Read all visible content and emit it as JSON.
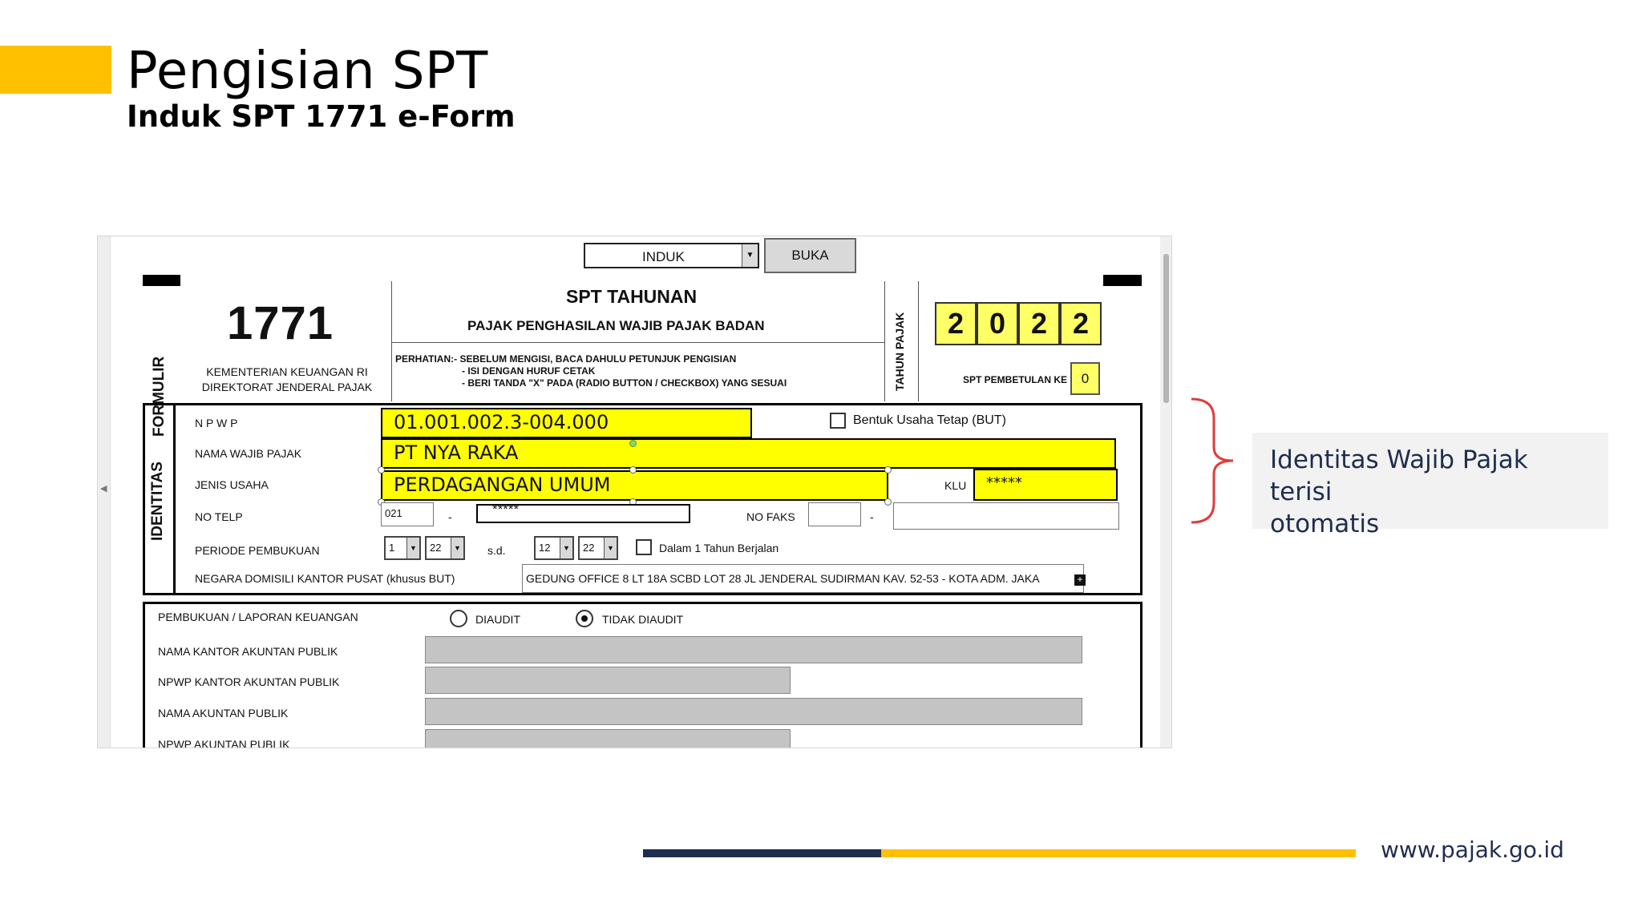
{
  "slide": {
    "title": "Pengisian SPT",
    "subtitle": "Induk SPT 1771 e-Form",
    "footer_url": "www.pajak.go.id",
    "accent_color": "#FFC000",
    "navy_color": "#1f2d50"
  },
  "callout": {
    "line1": "Identitas Wajib Pajak terisi",
    "line2": "otomatis"
  },
  "form": {
    "dropdown_value": "INDUK",
    "open_button": "BUKA",
    "formulir_label": "FORMULIR",
    "form_number": "1771",
    "ministry_line1": "KEMENTERIAN KEUANGAN RI",
    "ministry_line2": "DIREKTORAT JENDERAL PAJAK",
    "spt_title": "SPT TAHUNAN",
    "spt_subtitle": "PAJAK PENGHASILAN WAJIB PAJAK BADAN",
    "notice_line1": "PERHATIAN:- SEBELUM MENGISI, BACA DAHULU PETUNJUK PENGISIAN",
    "notice_line2": "- ISI DENGAN HURUF CETAK",
    "notice_line3": "- BERI TANDA \"X\" PADA (RADIO BUTTON / CHECKBOX) YANG SESUAI",
    "tahun_pajak_label": "TAHUN PAJAK",
    "year_digits": [
      "2",
      "0",
      "2",
      "2"
    ],
    "pembetulan_label": "SPT PEMBETULAN KE",
    "pembetulan_value": "0",
    "identitas_label": "IDENTITAS",
    "npwp_label": "N P W P",
    "npwp_value": "01.001.002.3-004.000",
    "but_label": "Bentuk Usaha Tetap (BUT)",
    "nama_label": "NAMA WAJIB PAJAK",
    "nama_value": "PT NYA RAKA",
    "jenis_label": "JENIS USAHA",
    "jenis_value": "PERDAGANGAN UMUM",
    "klu_label": "KLU",
    "klu_value": "*****",
    "telp_label": "NO TELP",
    "telp_area": "021",
    "telp_dash": "-",
    "telp_number": "*****",
    "faks_label": "NO FAKS",
    "faks_dash": "-",
    "periode_label": "PERIODE PEMBUKUAN",
    "periode_from_month": "1",
    "periode_from_year": "22",
    "periode_sd": "s.d.",
    "periode_to_month": "12",
    "periode_to_year": "22",
    "dalam_label": "Dalam 1 Tahun Berjalan",
    "negara_label": "NEGARA DOMISILI KANTOR PUSAT (khusus BUT)",
    "negara_value": "GEDUNG OFFICE 8 LT 18A SCBD LOT 28 JL JENDERAL SUDIRMAN KAV. 52-53 - KOTA ADM. JAKA",
    "pembukuan_label": "PEMBUKUAN / LAPORAN KEUANGAN",
    "diaudit_label": "DIAUDIT",
    "tidak_diaudit_label": "TIDAK DIAUDIT",
    "kap_nama_label": "NAMA KANTOR AKUNTAN PUBLIK",
    "kap_npwp_label": "NPWP KANTOR AKUNTAN PUBLIK",
    "ap_nama_label": "NAMA AKUNTAN PUBLIK",
    "ap_npwp_label": "NPWP AKUNTAN PUBLIK"
  }
}
